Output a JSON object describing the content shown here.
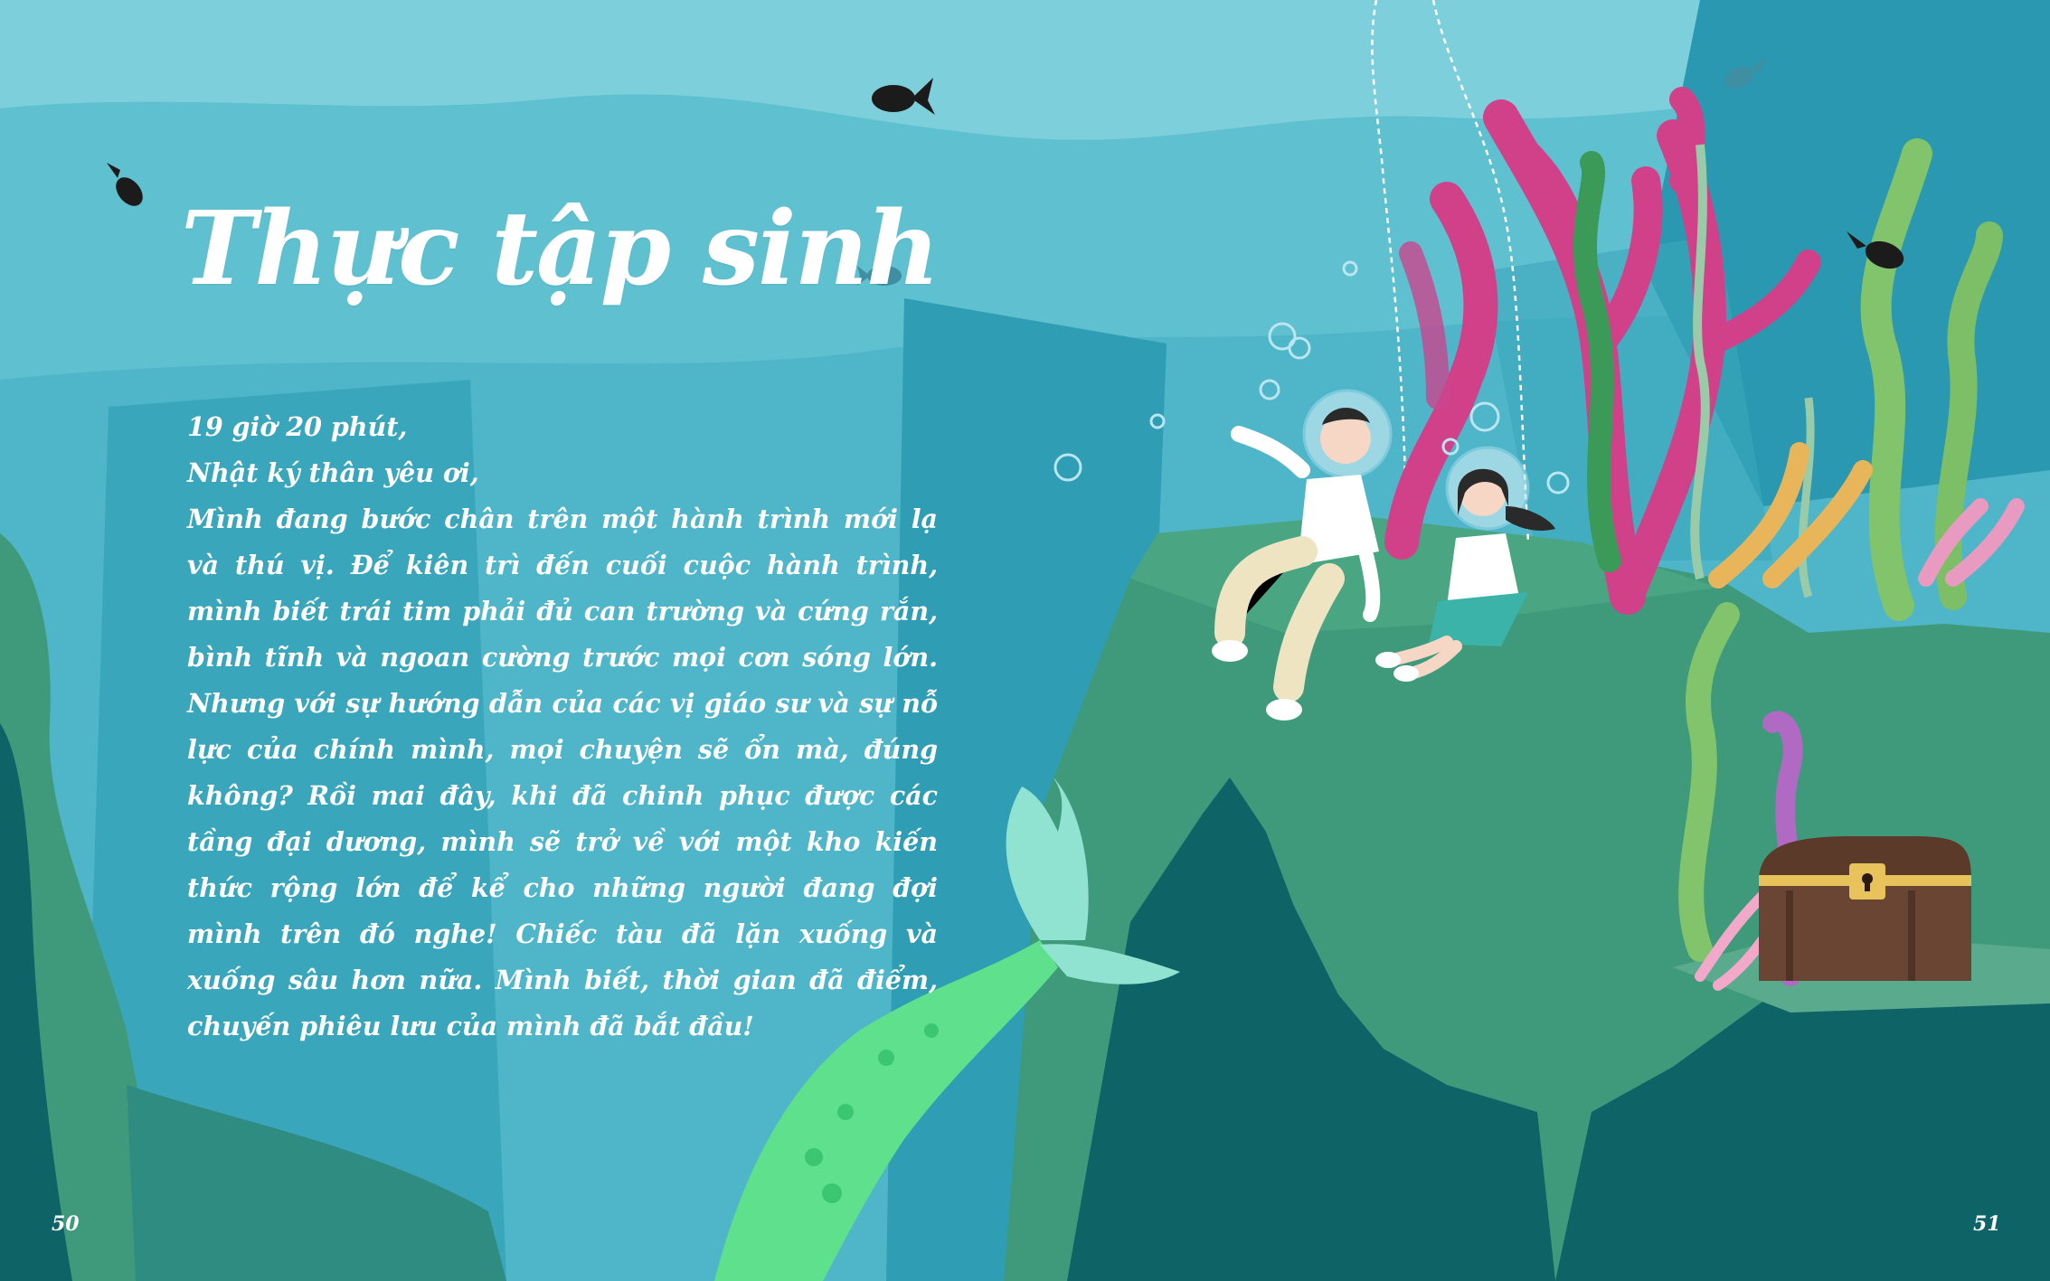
{
  "title": "Thực tập sinh",
  "diary": {
    "time": "19 giờ 20 phút,",
    "greeting": "Nhật ký thân yêu ơi,",
    "body": "Mình đang bước chân trên một hành trình mới lạ và thú vị. Để kiên trì đến cuối cuộc hành trình, mình biết trái tim phải đủ can trường và cứng rắn, bình tĩnh và ngoan cường trước mọi cơn sóng lớn. Nhưng với sự hướng dẫn của các vị giáo sư và sự nỗ lực của chính mình, mọi chuyện sẽ ổn mà, đúng không? Rồi mai đây, khi đã chinh phục được các tầng đại dương, mình sẽ trở về với một kho kiến thức rộng lớn để kể cho những người đang đợi mình trên đó nghe! Chiếc tàu đã lặn xuống và xuống sâu hơn nữa. Mình biết, thời gian đã điểm, chuyến phiêu lưu của mình đã bắt đầu!"
  },
  "page_numbers": {
    "left": "50",
    "right": "51"
  },
  "colors": {
    "water_surface": "#72ccd8",
    "water_mid": "#4fb5c8",
    "water_deep": "#2e9fb4",
    "rock_green": "#3f9a7c",
    "rock_dark": "#0e6366",
    "coral_pink": "#d1418a",
    "seaweed_green": "#82c46b",
    "mermaid_tail": "#5ee08c",
    "text": "#ffffff"
  },
  "icons": [
    "fish-icon",
    "bubble-icon",
    "treasure-chest-icon",
    "mermaid-tail-icon",
    "coral-icon",
    "seaweed-icon",
    "diver-boy-icon",
    "diver-girl-icon"
  ]
}
